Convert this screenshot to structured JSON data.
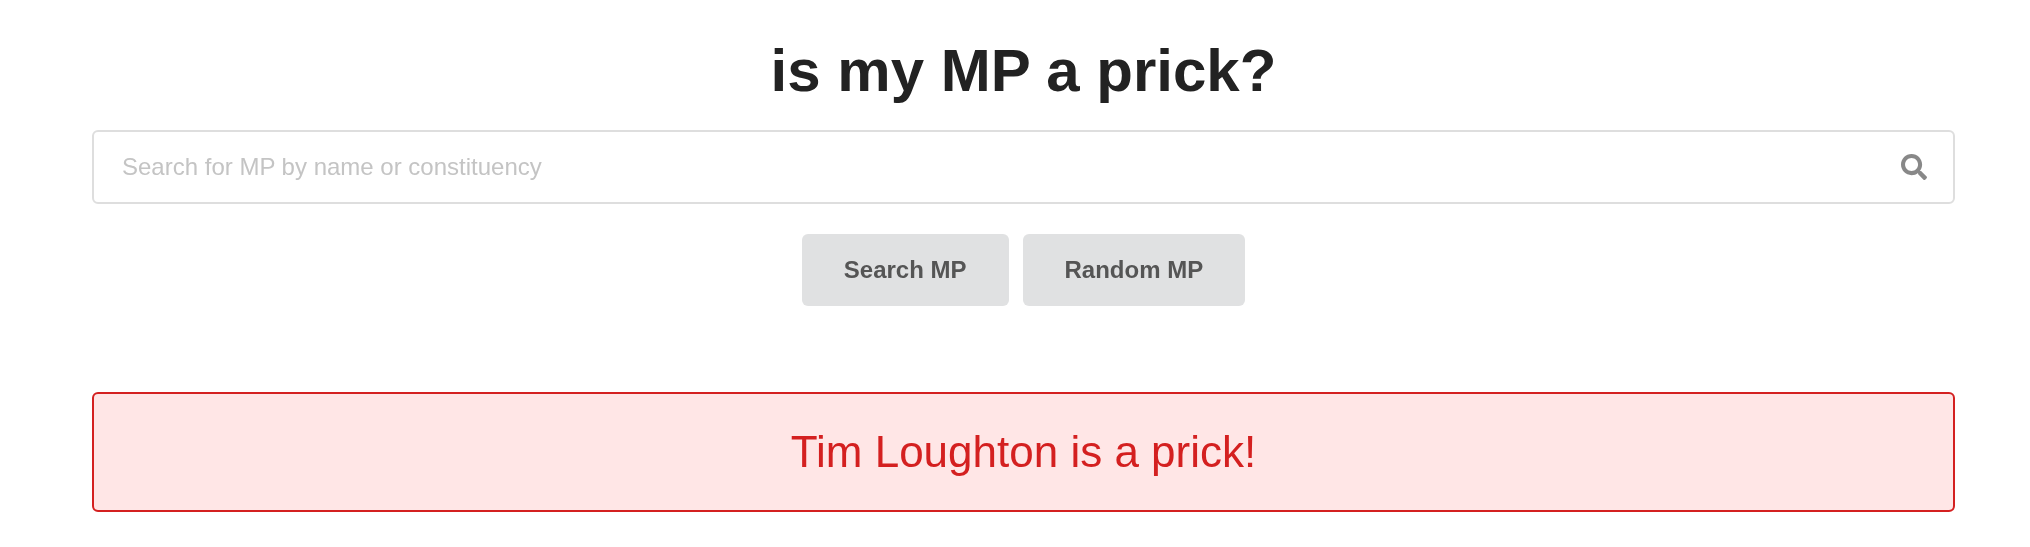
{
  "title": "is my MP a prick?",
  "search": {
    "placeholder": "Search for MP by name or constituency"
  },
  "buttons": [
    "Search MP",
    "Random MP"
  ],
  "result": {
    "kind": "error",
    "message": "Tim Loughton is a prick!"
  }
}
